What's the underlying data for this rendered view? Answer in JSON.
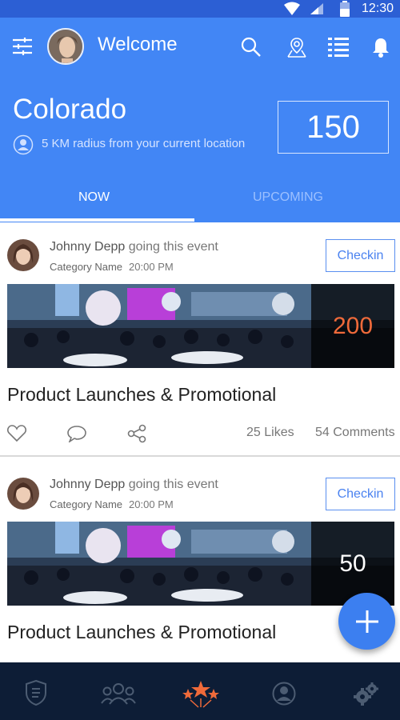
{
  "status_bar": {
    "time": "12:30"
  },
  "header": {
    "title": "Welcome",
    "location": "Colorado",
    "radius_text": "5 KM radius from your current location",
    "count": "150"
  },
  "tabs": [
    {
      "label": "NOW",
      "active": true
    },
    {
      "label": "UPCOMING",
      "active": false
    }
  ],
  "posts": [
    {
      "user": "Johnny Depp",
      "action": "going this event",
      "category": "Category Name",
      "time": "20:00 PM",
      "checkin_label": "Checkin",
      "count": "200",
      "count_color": "#ef6a3a",
      "title": "Product Launches & Promotional",
      "likes": "25 Likes",
      "comments": "54 Comments"
    },
    {
      "user": "Johnny Depp",
      "action": "going this event",
      "category": "Category Name",
      "time": "20:00 PM",
      "checkin_label": "Checkin",
      "count": "50",
      "count_color": "#ffffff",
      "title": "Product Launches & Promotional"
    }
  ],
  "fab": {
    "icon": "plus-icon"
  },
  "bottom_nav": [
    "news-shield-icon",
    "group-icon",
    "stars-icon",
    "profile-icon",
    "settings-gears-icon"
  ],
  "colors": {
    "primary": "#4286f5",
    "status_bar": "#2c5fd4",
    "bottom_nav": "#0d1d36",
    "accent": "#ef6a3a"
  }
}
